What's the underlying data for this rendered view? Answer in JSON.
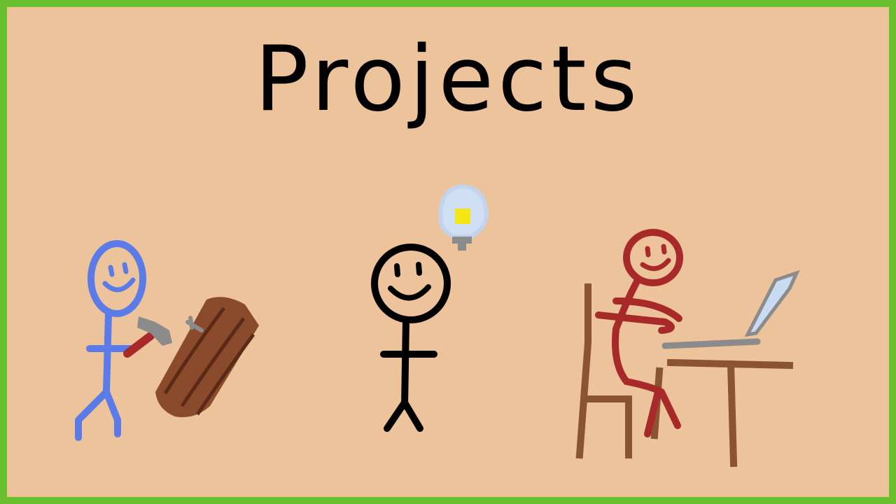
{
  "title": "Projects",
  "colors": {
    "border": "#6abf2e",
    "background": "#edc39b",
    "builder": "#5b7be8",
    "thinker": "#000000",
    "worker": "#a8292a",
    "wood": "#8a4a2c",
    "furniture": "#8a5432",
    "bulb_glow": "#cfe0f5",
    "bulb_light": "#f5e616",
    "metal": "#8b8b8b"
  },
  "scene": {
    "figures": [
      {
        "name": "builder-figure",
        "icon": "stick-figure-hammering-icon"
      },
      {
        "name": "thinker-figure",
        "icon": "stick-figure-idea-icon"
      },
      {
        "name": "worker-figure",
        "icon": "stick-figure-laptop-icon"
      }
    ]
  }
}
